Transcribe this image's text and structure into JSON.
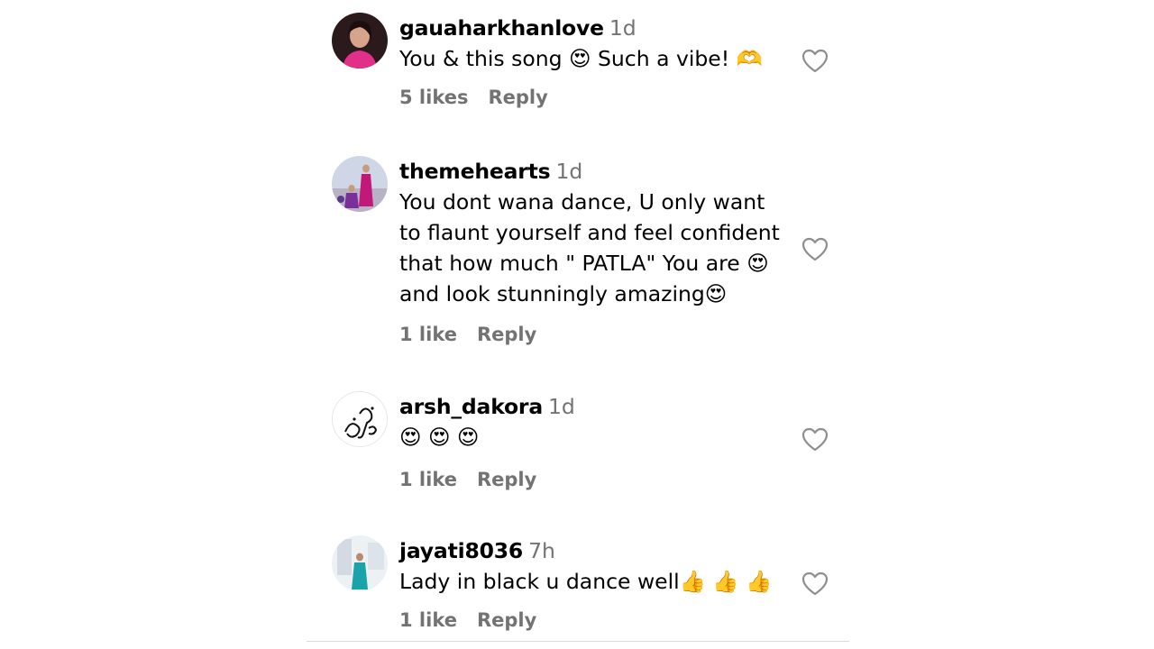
{
  "comments": [
    {
      "username": "gauaharkhanlove",
      "time": "1d",
      "text": "You & this song 😍 Such a vibe! 🫶",
      "likes": "5 likes",
      "reply": "Reply",
      "avatar": "profile-photo-woman-pink"
    },
    {
      "username": "themehearts",
      "time": "1d",
      "text": "You dont wana dance, U only want\nto flaunt yourself and feel confident\nthat how much \" PATLA\" You are 😍\nand look stunningly amazing😍",
      "likes": "1 like",
      "reply": "Reply",
      "avatar": "profile-photo-dancers"
    },
    {
      "username": "arsh_dakora",
      "time": "1d",
      "text": "😍 😍 😍",
      "likes": "1 like",
      "reply": "Reply",
      "avatar": "calligraphy-logo"
    },
    {
      "username": "jayati8036",
      "time": "7h",
      "text": "Lady in black u dance well👍 👍 👍",
      "likes": "1 like",
      "reply": "Reply",
      "avatar": "profile-photo-woman-teal"
    }
  ],
  "colors": {
    "text": "#000000",
    "secondary": "#737373",
    "heart_outline": "#8e8e8e",
    "divider": "#dbdbdb"
  },
  "icons": {
    "like": "heart-outline-icon"
  }
}
